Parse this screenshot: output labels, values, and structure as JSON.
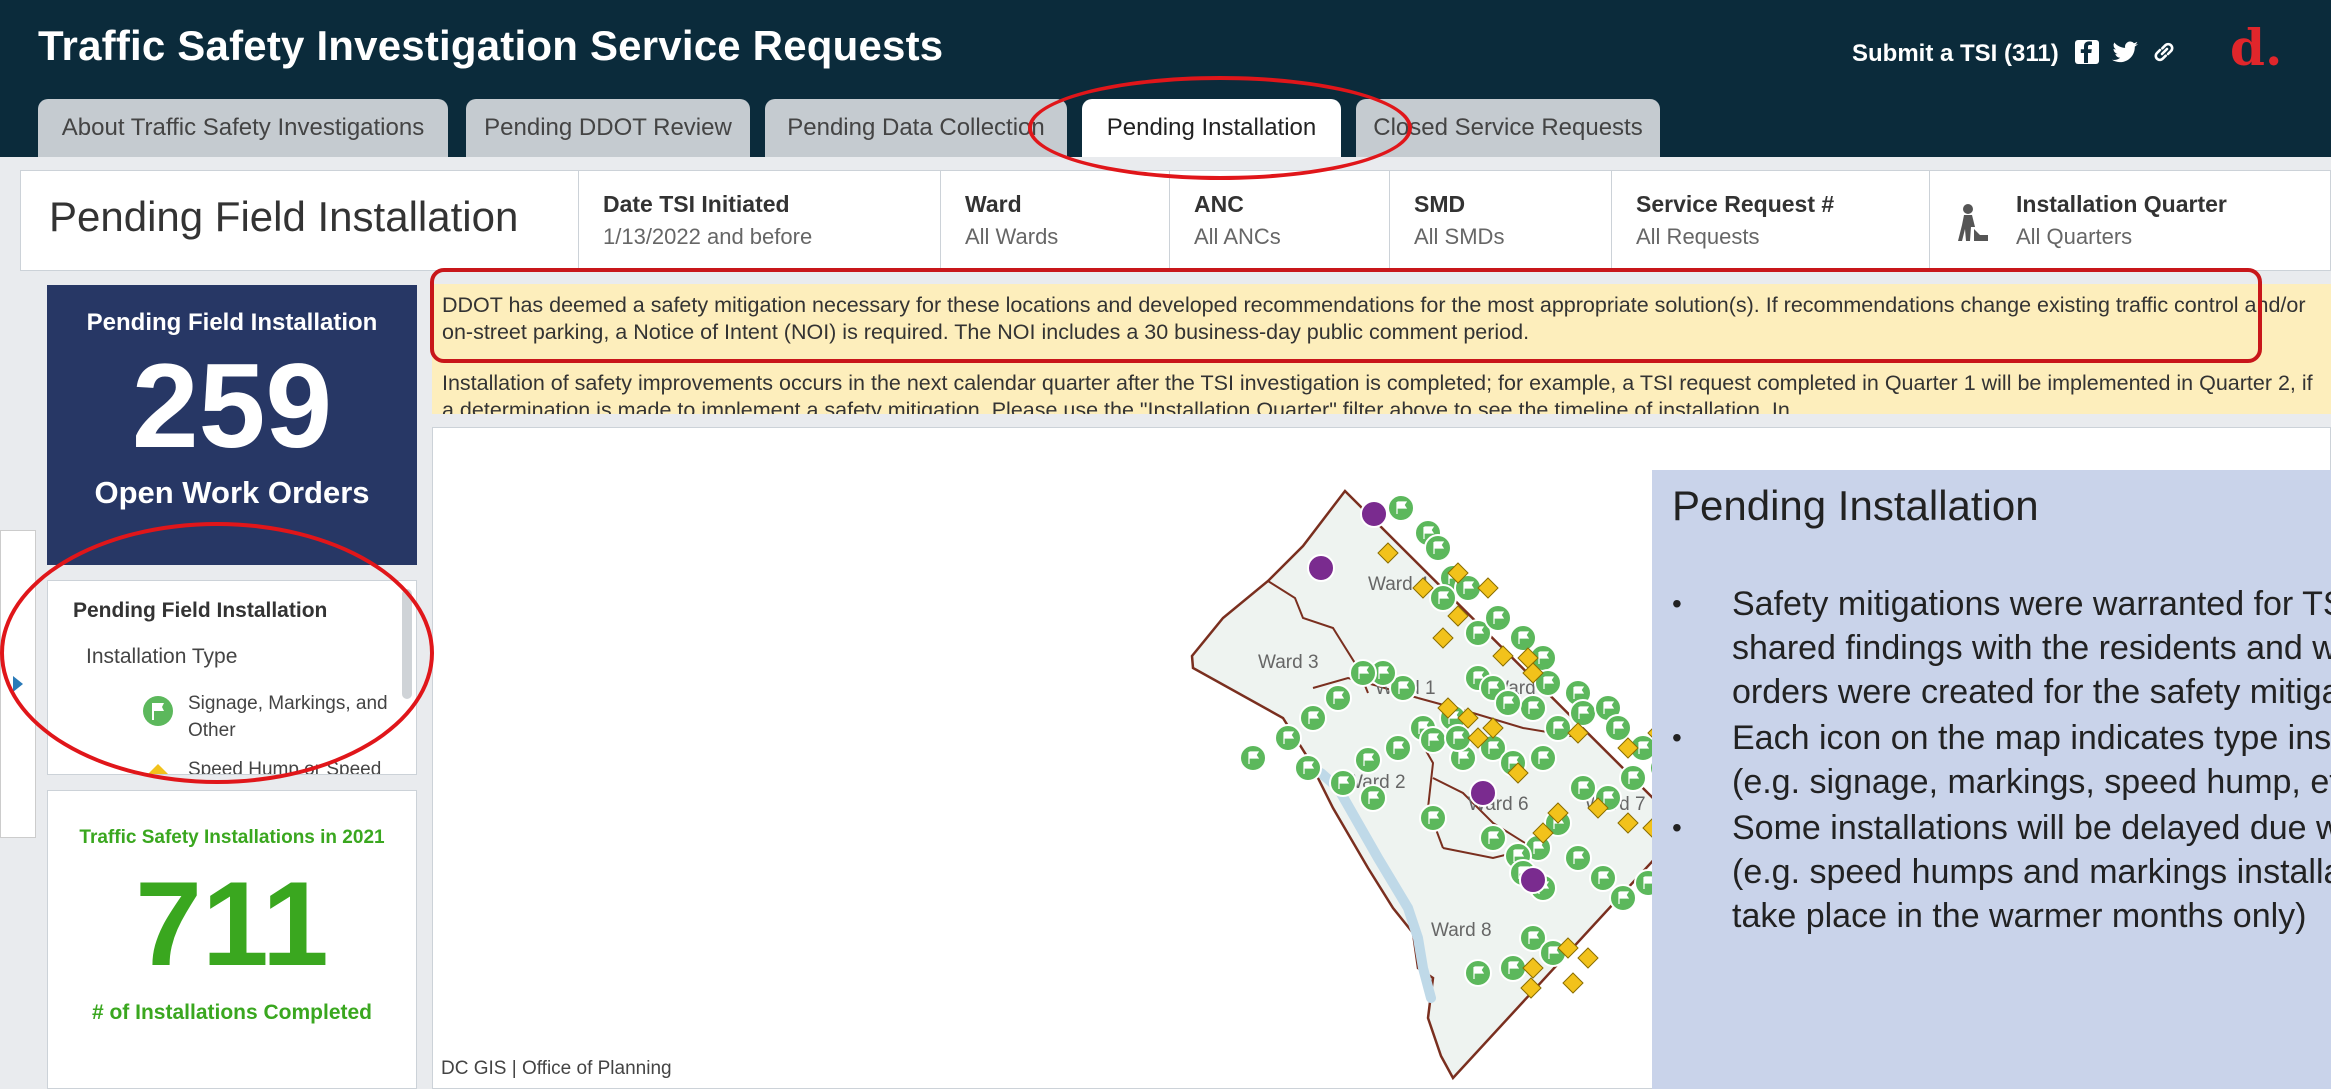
{
  "header": {
    "title": "Traffic Safety Investigation Service Requests",
    "submit_link": "Submit a TSI (311)",
    "social_icons": [
      "facebook-icon",
      "twitter-icon",
      "link-icon"
    ],
    "brand_logo": "d."
  },
  "tabs": [
    {
      "label": "About Traffic Safety Investigations",
      "active": false
    },
    {
      "label": "Pending DDOT Review",
      "active": false
    },
    {
      "label": "Pending Data Collection",
      "active": false
    },
    {
      "label": "Pending Installation",
      "active": true
    },
    {
      "label": "Closed Service Requests",
      "active": false
    }
  ],
  "filterbar": {
    "title": "Pending Field Installation",
    "filters": [
      {
        "label": "Date TSI Initiated",
        "value": "1/13/2022 and before"
      },
      {
        "label": "Ward",
        "value": "All Wards"
      },
      {
        "label": "ANC",
        "value": "All ANCs"
      },
      {
        "label": "SMD",
        "value": "All SMDs"
      },
      {
        "label": "Service Request #",
        "value": "All Requests"
      },
      {
        "label": "Installation Quarter",
        "value": "All Quarters",
        "icon": "worker-icon"
      }
    ]
  },
  "kpi_pending": {
    "heading": "Pending Field Installation",
    "value": "259",
    "subtitle": "Open Work Orders"
  },
  "legend": {
    "heading": "Pending Field Installation",
    "subheading": "Installation Type",
    "items": [
      {
        "label": "Signage, Markings, and Other",
        "icon": "green-flag-icon"
      },
      {
        "label": "Speed Hump or Speed",
        "icon": "speed-hump-icon"
      }
    ]
  },
  "kpi_installed": {
    "heading": "Traffic Safety Installations in 2021",
    "value": "711",
    "subtitle": "# of Installations Completed"
  },
  "notice": {
    "paragraph_1": "DDOT has deemed a safety mitigation necessary for these locations and developed recommendations for the most appropriate solution(s). If recommendations change existing traffic control and/or on-street parking, a Notice of Intent (NOI) is required. The NOI includes a 30 business-day public comment period.",
    "paragraph_2": "Installation of safety improvements occurs in the next calendar quarter after the TSI investigation is completed; for example, a TSI request completed in Quarter 1 will be implemented in Quarter 2, if a determination is made to implement a safety mitigation. Please use the \"Installation Quarter\" filter above to see the timeline of installation. In"
  },
  "map": {
    "ward_labels": [
      "Ward 4",
      "Ward 3",
      "Ward 1",
      "Ward 5",
      "Ward 2",
      "Ward 6",
      "Ward 7",
      "Ward 8"
    ],
    "attribution": "DC GIS | Office of Planning",
    "colors": {
      "green_marker": "#5cb85c",
      "yellow_marker": "#f2c21b",
      "purple_marker": "#7a2b8f",
      "boundary": "#7a2f1f"
    }
  },
  "info_panel": {
    "title": "Pending Installation",
    "bullets": [
      "Safety mitigations were warranted for TSI. DDOT shared findings with the residents and work orders were created for the safety mitigations.",
      "Each icon on the map indicates  type installations (e.g. signage, markings, speed hump, etc.)",
      "Some installations will be delayed due weather. (e.g. speed humps and markings installations take place in the warmer months only)"
    ]
  },
  "colors": {
    "header_bg": "#0b2b3b",
    "kpi_dark_bg": "#273765",
    "kpi_green": "#3aa71f",
    "notice_bg": "#fdeebc",
    "info_bg": "#c9d3ea",
    "annotation_red": "#e0161a"
  }
}
